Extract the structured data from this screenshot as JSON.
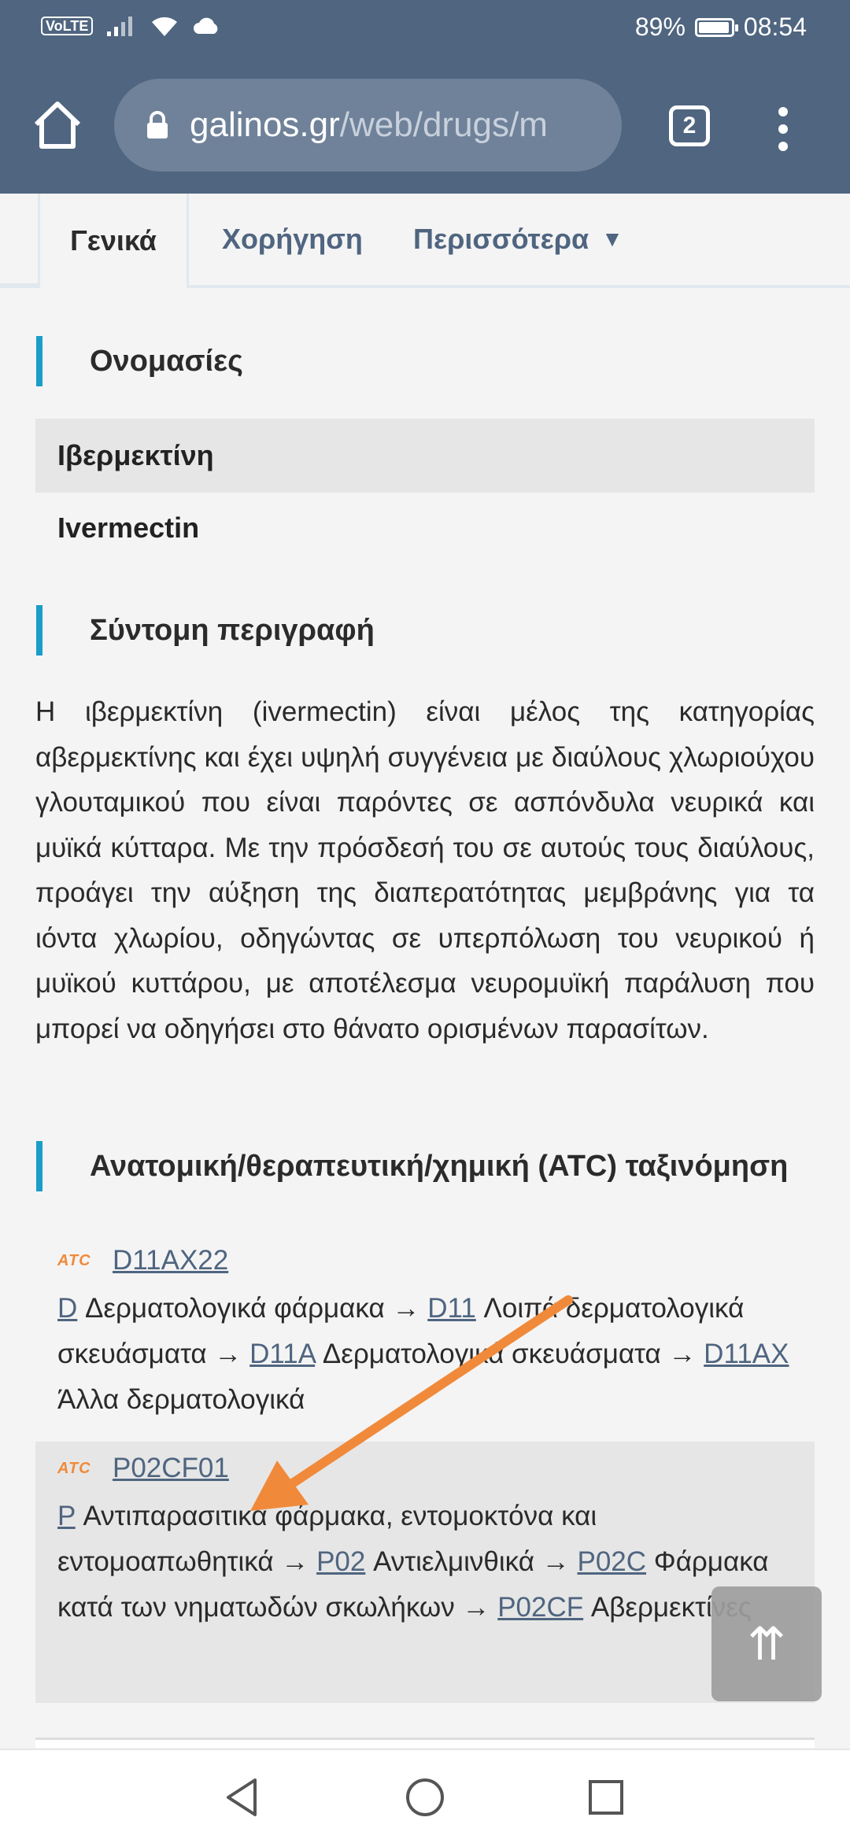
{
  "status_bar": {
    "left_label": "VoLTE",
    "battery": "89%",
    "battery_level": 0.89,
    "time": "08:54"
  },
  "browser": {
    "url_domain": "galinos.gr",
    "url_path": "/web/drugs/m",
    "tab_count": "2",
    "icons": [
      "home-icon",
      "lock-icon",
      "tabs-icon",
      "menu-icon"
    ]
  },
  "tabs": [
    {
      "label": "Γενικά",
      "active": true
    },
    {
      "label": "Χορήγηση",
      "active": false
    },
    {
      "label": "Περισσότερα",
      "active": false,
      "caret": "▼"
    }
  ],
  "sections": {
    "names": {
      "title": "Ονομασίες",
      "items": [
        "Ιβερμεκτίνη",
        "Ivermectin"
      ]
    },
    "description": {
      "title": "Σύντομη περιγραφή",
      "text": "Η ιβερμεκτίνη (ivermectin) είναι μέλος της κατηγορίας αβερμεκτίνης και έχει υψηλή συγγένεια με διαύλους χλωριούχου γλουταμικού που είναι παρόντες σε ασπόνδυλα νευρικά και μυϊκά κύτταρα. Με την πρόσδεσή του σε αυτούς τους διαύλους, προάγει την αύξηση της διαπερατότητας μεμβράνης για τα ιόντα χλωρίου, οδηγώντας σε υπερπόλωση του νευρικού ή μυϊκού κυττάρου, με αποτέλεσμα νευρομυϊκή παράλυση που μπορεί να οδηγήσει στο θάνατο ορισμένων παρασίτων."
    },
    "atc": {
      "title": "Ανατομική/θεραπευτική/χημική (ATC) ταξινόμηση",
      "logo": "ATC",
      "entries": [
        {
          "code": "D11AX22",
          "path": [
            {
              "code": "D",
              "label": "Δερματολογικά φάρμακα"
            },
            {
              "code": "D11",
              "label": "Λοιπά δερματολογικά σκευάσματα"
            },
            {
              "code": "D11A",
              "label": "Δερματολογικά σκευάσματα"
            },
            {
              "code": "D11AX",
              "label": "Άλλα δερματολογικά"
            }
          ]
        },
        {
          "code": "P02CF01",
          "path": [
            {
              "code": "P",
              "label": "Αντιπαρασιτικά φάρμακα, εντομοκτόνα και εντομοαπωθητικά"
            },
            {
              "code": "P02",
              "label": "Αντιελμινθικά"
            },
            {
              "code": "P02C",
              "label": "Φάρμακα κατά των νηματωδών σκωλήκων"
            },
            {
              "code": "P02CF",
              "label": "Αβερμεκτίνες"
            }
          ]
        }
      ],
      "arrow_sep": "→"
    }
  },
  "scroll_top_glyph": "⇈",
  "annotation_arrow_color": "#f08a3a",
  "accent_color": "#1a9dc8",
  "toolbar_color": "#4f6580",
  "nav": [
    "back-icon",
    "home-circle-icon",
    "recents-icon"
  ]
}
